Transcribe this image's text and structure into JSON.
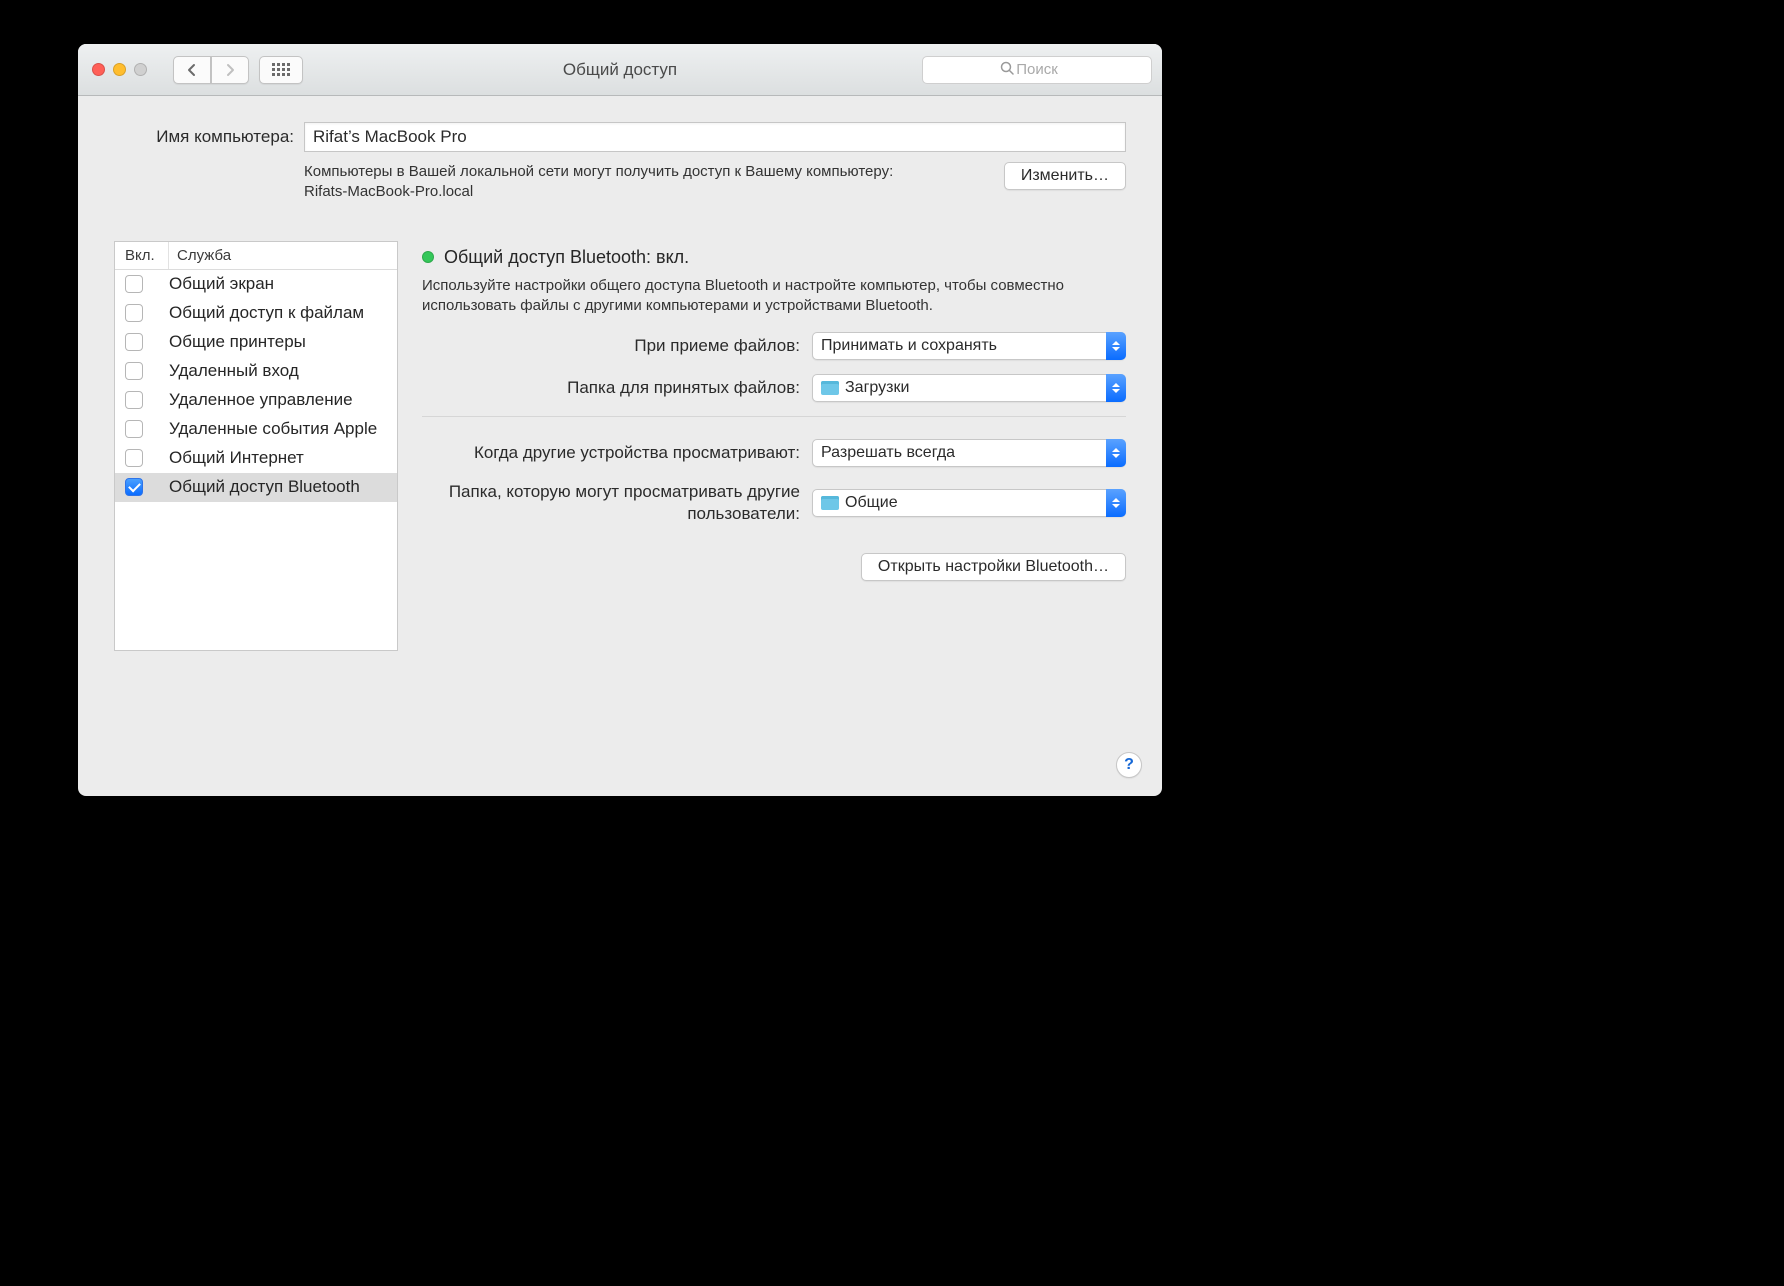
{
  "window": {
    "title": "Общий доступ",
    "search_placeholder": "Поиск"
  },
  "computer": {
    "label": "Имя компьютера:",
    "name": "Rifat’s MacBook Pro",
    "description": "Компьютеры в Вашей локальной сети могут получить доступ к Вашему компьютеру: Rifats-MacBook-Pro.local",
    "edit_button": "Изменить…"
  },
  "services": {
    "header_on": "Вкл.",
    "header_name": "Служба",
    "items": [
      {
        "name": "Общий экран",
        "checked": false,
        "selected": false
      },
      {
        "name": "Общий доступ к файлам",
        "checked": false,
        "selected": false
      },
      {
        "name": "Общие принтеры",
        "checked": false,
        "selected": false
      },
      {
        "name": "Удаленный вход",
        "checked": false,
        "selected": false
      },
      {
        "name": "Удаленное управление",
        "checked": false,
        "selected": false
      },
      {
        "name": "Удаленные события Apple",
        "checked": false,
        "selected": false
      },
      {
        "name": "Общий Интернет",
        "checked": false,
        "selected": false
      },
      {
        "name": "Общий доступ Bluetooth",
        "checked": true,
        "selected": true
      }
    ]
  },
  "detail": {
    "status_title": "Общий доступ Bluetooth: вкл.",
    "status_color": "#34c759",
    "description": "Используйте настройки общего доступа Bluetooth и настройте компьютер, чтобы совместно использовать файлы с другими компьютерами и устройствами Bluetooth.",
    "receiving_label": "При приеме файлов:",
    "receiving_value": "Принимать и сохранять",
    "receiving_folder_label": "Папка для принятых файлов:",
    "receiving_folder_value": "Загрузки",
    "browsing_label": "Когда другие устройства просматривают:",
    "browsing_value": "Разрешать всегда",
    "browsing_folder_label": "Папка, которую могут просматривать другие пользователи:",
    "browsing_folder_value": "Общие",
    "open_bt_button": "Открыть настройки Bluetooth…"
  },
  "help_icon": "?"
}
